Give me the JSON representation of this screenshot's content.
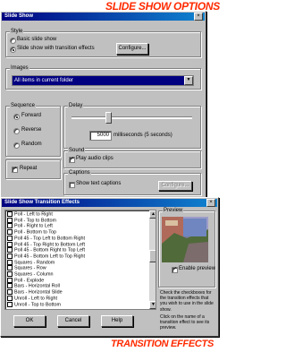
{
  "headings": {
    "top": "SLIDE SHOW OPTIONS",
    "bottom": "TRANSITION EFFECTS"
  },
  "main_dialog": {
    "title": "Slide Show",
    "style": {
      "label": "Style",
      "options": [
        "Basic slide show",
        "Slide show with transition effects"
      ],
      "selected": "Slide show with transition effects",
      "configure_button": "Configure..."
    },
    "images": {
      "label": "Images",
      "selected": "All items in current folder"
    },
    "sequence": {
      "label": "Sequence",
      "options": [
        "Forward",
        "Reverse",
        "Random"
      ],
      "selected": "Forward",
      "repeat_label": "Repeat",
      "repeat_checked": true
    },
    "delay": {
      "label": "Delay",
      "value": "5000",
      "unit": "milliseconds  (5 seconds)",
      "slider_fraction": 0.3
    },
    "sound": {
      "label": "Sound",
      "play_audio_label": "Play audio clips",
      "play_audio_checked": true
    },
    "captions": {
      "label": "Captions",
      "show_text_label": "Show text captions",
      "show_text_checked": false,
      "configure_button": "Configure..."
    }
  },
  "transition_dialog": {
    "title": "Slide Show Transition Effects",
    "effects": [
      "Poll - Left to Right",
      "Poll - Top to Bottom",
      "Poll - Right to Left",
      "Poll - Bottom to Top",
      "Poll 45 - Top Left to Bottom Right",
      "Poll 45 - Top Right to Bottom Left",
      "Poll 45 - Bottom Right to Top Left",
      "Poll 45 - Bottom Left to Top Right",
      "Squares - Random",
      "Squares - Row",
      "Squares - Column",
      "Poll - Explode",
      "Bars - Horizontal Roll",
      "Bars - Horizontal Slide",
      "Unroll - Left to Right",
      "Unroll - Top to Bottom"
    ],
    "preview": {
      "label": "Preview",
      "enable_label": "Enable preview",
      "enable_checked": true
    },
    "help_text": [
      "Check the checkboxes for the transition effects that you wish to use in the slide show.",
      "Click on the name of a transition effect to see its preview."
    ],
    "buttons": {
      "ok": "OK",
      "cancel": "Cancel",
      "help": "Help"
    }
  }
}
